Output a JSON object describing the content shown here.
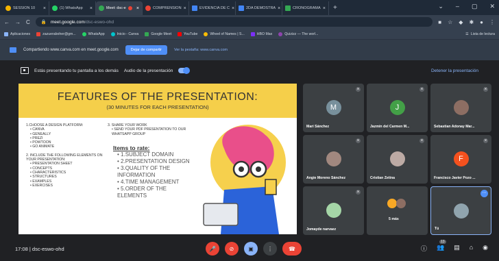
{
  "tabs": [
    {
      "label": "SESSION 10",
      "color": "#f4b400",
      "active": false
    },
    {
      "label": "(1) WhatsApp",
      "color": "#25d366",
      "active": false
    },
    {
      "label": "Meet: dsc-e",
      "color": "#34a853",
      "active": true
    },
    {
      "label": "COMPRENSION",
      "color": "#ea4335",
      "active": false
    },
    {
      "label": "EVIDENCIA DE C",
      "color": "#4285f4",
      "active": false
    },
    {
      "label": "2DA DEMOSTRA",
      "color": "#4285f4",
      "active": false
    },
    {
      "label": "CRONOGRAMA",
      "color": "#34a853",
      "active": false
    }
  ],
  "address": {
    "domain": "meet.google.com",
    "path": "/dsc-eswo-ohd"
  },
  "bookmarks": [
    {
      "label": "Aplicaciones",
      "color": "#8ab4f8"
    },
    {
      "label": "zazueraboher@gm...",
      "color": "#ea4335"
    },
    {
      "label": "WhatsApp",
      "color": "#25d366"
    },
    {
      "label": "Inicio - Canva",
      "color": "#00c4cc"
    },
    {
      "label": "Google Meet",
      "color": "#34a853"
    },
    {
      "label": "YouTube",
      "color": "#ff0000"
    },
    {
      "label": "Wheel of Names | S...",
      "color": "#fbbc04"
    },
    {
      "label": "HBO Max",
      "color": "#7b2ff7"
    },
    {
      "label": "Quizizz — The worl...",
      "color": "#8e44ad"
    }
  ],
  "reading_list": "Lista de lectura",
  "sharebar": {
    "text": "Compartiendo www.canva.com en meet.google.com",
    "stop_button": "Dejar de compartir",
    "switch_link": "Ver la pestaña: www.canva.com"
  },
  "presbar": {
    "text": "Estás presentando tu pantalla a los demás",
    "audio": "Audio de la presentación",
    "stop": "Detener la presentación"
  },
  "slide": {
    "title": "FEATURES OF THE PRESENTATION:",
    "subtitle": "(30 MINUTES FOR EACH PRESENTATION)",
    "step1": "1.CHOOSE A DESIGN PLATFORM:",
    "platforms": [
      "CANVA",
      "GENEALLY",
      "PREZI",
      "POWTOON",
      "GO ANIMATE"
    ],
    "step2": "2. INCLUDE THE FOLLOWING ELEMENTS ON YOUR PRESENTATION:",
    "elements": [
      "PRESENTATION SHEET",
      "CONCEPTS",
      "CHARACTERISTICS",
      "STRUCTURES",
      "EXAMPLES",
      "EXERCISES"
    ],
    "step3": "3. SHARE YOUR WORK",
    "share_items": [
      "SEND YOUR PDF PRESENTATION TO OUR WHATSAPP GROUP"
    ],
    "rate_title": "Items to rate:",
    "rate_items": [
      "1.SUBJECT DOMAIN",
      "2.PRESENTATION DESIGN",
      "3.QUALITY OF THE INFORMATION",
      "4.TIME MANAGEMENT",
      "5.ORDER OF THE ELEMENTS"
    ]
  },
  "participants": [
    {
      "name": "Mari Sánchez",
      "initial": "M",
      "color": "#78909c"
    },
    {
      "name": "Jazmín del Carmen M...",
      "initial": "J",
      "color": "#43a047"
    },
    {
      "name": "Sebastian Adonay Mar...",
      "initial": "",
      "color": "#8d6e63"
    },
    {
      "name": "Angie Moreno Sánchez",
      "initial": "",
      "color": "#a1887f"
    },
    {
      "name": "Cristian Zetina",
      "initial": "",
      "color": "#bcaaa4"
    },
    {
      "name": "Francisco Javier Pozo ...",
      "initial": "F",
      "color": "#f4511e"
    },
    {
      "name": "Jomayde narvaez",
      "initial": "",
      "color": "#a5d6a7"
    },
    {
      "name": "5 más",
      "initial": "",
      "color": "#f9a825"
    },
    {
      "name": "Tú",
      "initial": "",
      "color": "#90a4ae"
    }
  ],
  "meeting": {
    "time": "17:08",
    "separator": "|",
    "code": "dsc-eswo-ohd"
  },
  "people_count": "13"
}
